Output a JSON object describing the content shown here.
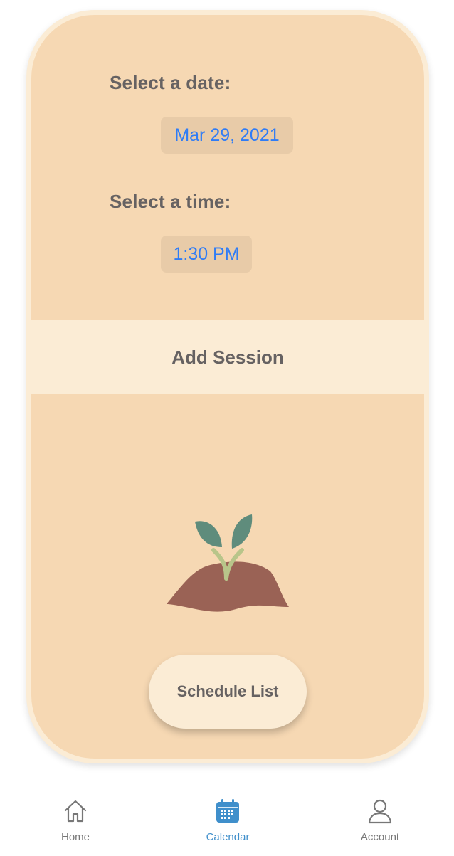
{
  "form": {
    "date_label": "Select a date:",
    "date_value": "Mar 29, 2021",
    "time_label": "Select a time:",
    "time_value": "1:30 PM",
    "add_session_label": "Add Session"
  },
  "schedule_button_label": "Schedule List",
  "tabbar": {
    "active": "Calendar",
    "tabs": [
      {
        "label": "Home",
        "icon": "home-icon"
      },
      {
        "label": "Calendar",
        "icon": "calendar-icon"
      },
      {
        "label": "Account",
        "icon": "account-icon"
      }
    ]
  },
  "colors": {
    "card_background": "#f6d8b3",
    "band_background": "#fbecd5",
    "picker_text": "#2f7cf6",
    "active_tab": "#3f8fcb",
    "soil": "#9a6255",
    "leaf": "#5f8c7c",
    "stem": "#b8c58a"
  }
}
